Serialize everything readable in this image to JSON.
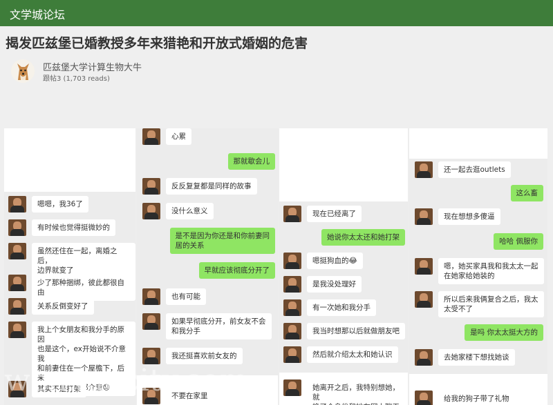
{
  "site": {
    "title": "文学城论坛"
  },
  "post": {
    "title": "揭发匹兹堡已婚教授多年来猎艳和开放式婚姻的危害",
    "author": "匹兹堡大学计算生物大牛",
    "meta": "跟帖3 (1,703 reads)"
  },
  "chat_panels": [
    {
      "messages": [
        {
          "side": "left",
          "text": "嗯嗯，我36了"
        },
        {
          "side": "left",
          "text": "有时候也觉得挺微妙的"
        },
        {
          "side": "left",
          "text": "虽然还住在一起，离婚之后，\n边界就变了"
        },
        {
          "side": "left",
          "text": "少了那种捆绑，彼此都很自由"
        },
        {
          "side": "left",
          "text": "关系反倒变好了"
        },
        {
          "side": "left",
          "text": "我上个女朋友和我分手的原因\n也是这个，ex开始说不介意我\n和前妻住在一个屋檐下，后来\n又说其实一直都介意😓"
        },
        {
          "side": "left",
          "text": "其实不是打架"
        }
      ]
    },
    {
      "messages": [
        {
          "side": "left",
          "text": "心累"
        },
        {
          "side": "right",
          "text": "那就歇会儿"
        },
        {
          "side": "left",
          "text": "反反复复都是同样的故事"
        },
        {
          "side": "left",
          "text": "没什么意义"
        },
        {
          "side": "right",
          "text": "是不是因为你还是和你前妻同\n居的关系"
        },
        {
          "side": "right",
          "text": "早就应该彻底分开了"
        },
        {
          "side": "left",
          "text": "也有可能"
        },
        {
          "side": "left",
          "text": "如果早彻底分开，前女友不会\n和我分手"
        },
        {
          "side": "left",
          "text": "我还挺喜欢前女友的"
        },
        {
          "side": "left",
          "text": "不要在家里"
        }
      ]
    },
    {
      "messages": [
        {
          "side": "left",
          "text": "现在已经离了"
        },
        {
          "side": "right",
          "text": "她说你太太还和她打架"
        },
        {
          "side": "left",
          "text": "嗯挺狗血的😂"
        },
        {
          "side": "left",
          "text": "是我没处理好"
        },
        {
          "side": "left",
          "text": "有一次她和我分手"
        },
        {
          "side": "left",
          "text": "我当时想那以后就做朋友吧"
        },
        {
          "side": "left",
          "text": "然后就介绍太太和她认识"
        },
        {
          "side": "left",
          "text": "她离开之后，我特别想她，就\n换了个身份和她在网上聊天"
        }
      ]
    },
    {
      "messages": [
        {
          "side": "left",
          "text": "还一起去逛outlets"
        },
        {
          "side": "right",
          "text": "这么畜"
        },
        {
          "side": "left",
          "text": "现在想想多傻逼"
        },
        {
          "side": "right",
          "text": "哈哈 佩服你"
        },
        {
          "side": "left",
          "text": "嗯，她买家具我和我太太一起\n在她家给她装的"
        },
        {
          "side": "left",
          "text": "所以后来我俩复合之后，我太\n太受不了"
        },
        {
          "side": "right",
          "text": "是吗 你太太挺大方的"
        },
        {
          "side": "left",
          "text": "去她家楼下想找她谈"
        },
        {
          "side": "left",
          "text": "给我的狗子带了礼物"
        }
      ]
    }
  ],
  "watermark": "wenxuecity.com"
}
